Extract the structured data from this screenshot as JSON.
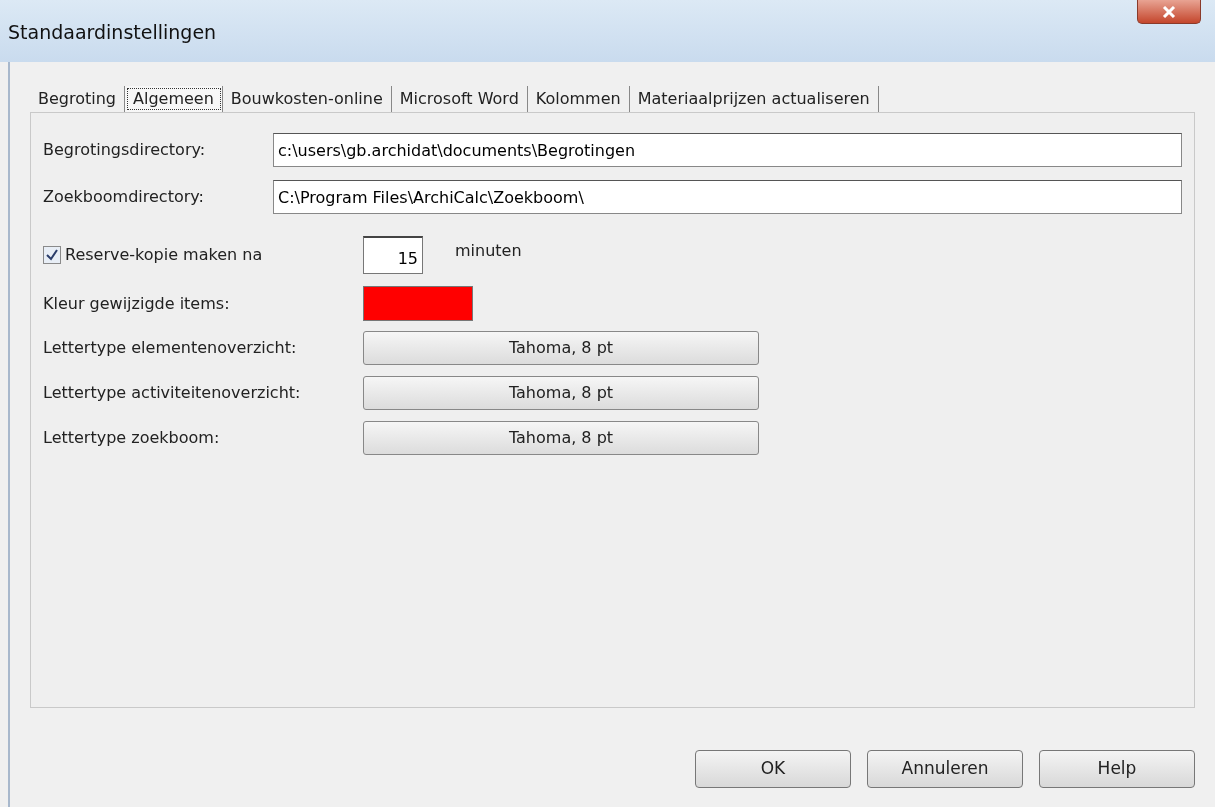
{
  "window": {
    "title": "Standaardinstellingen"
  },
  "tabs": [
    {
      "label": "Begroting",
      "selected": false
    },
    {
      "label": "Algemeen",
      "selected": true
    },
    {
      "label": "Bouwkosten-online",
      "selected": false
    },
    {
      "label": "Microsoft Word",
      "selected": false
    },
    {
      "label": "Kolommen",
      "selected": false
    },
    {
      "label": "Materiaalprijzen actualiseren",
      "selected": false
    }
  ],
  "directories": [
    {
      "label": "Begrotingsdirectory:",
      "value": "c:\\users\\gb.archidat\\documents\\Begrotingen"
    },
    {
      "label": "Zoekboomdirectory:",
      "value": "C:\\Program Files\\ArchiCalc\\Zoekboom\\"
    }
  ],
  "backup": {
    "label": "Reserve-kopie maken na",
    "checked": true,
    "value": "15",
    "unit": "minuten"
  },
  "changed_color": {
    "label": "Kleur gewijzigde items:",
    "color": "#ff0000"
  },
  "fonts": [
    {
      "label": "Lettertype elementenoverzicht:",
      "value": "Tahoma, 8 pt"
    },
    {
      "label": "Lettertype activiteitenoverzicht:",
      "value": "Tahoma, 8 pt"
    },
    {
      "label": "Lettertype zoekboom:",
      "value": "Tahoma, 8 pt"
    }
  ],
  "buttons": [
    "OK",
    "Annuleren",
    "Help"
  ]
}
